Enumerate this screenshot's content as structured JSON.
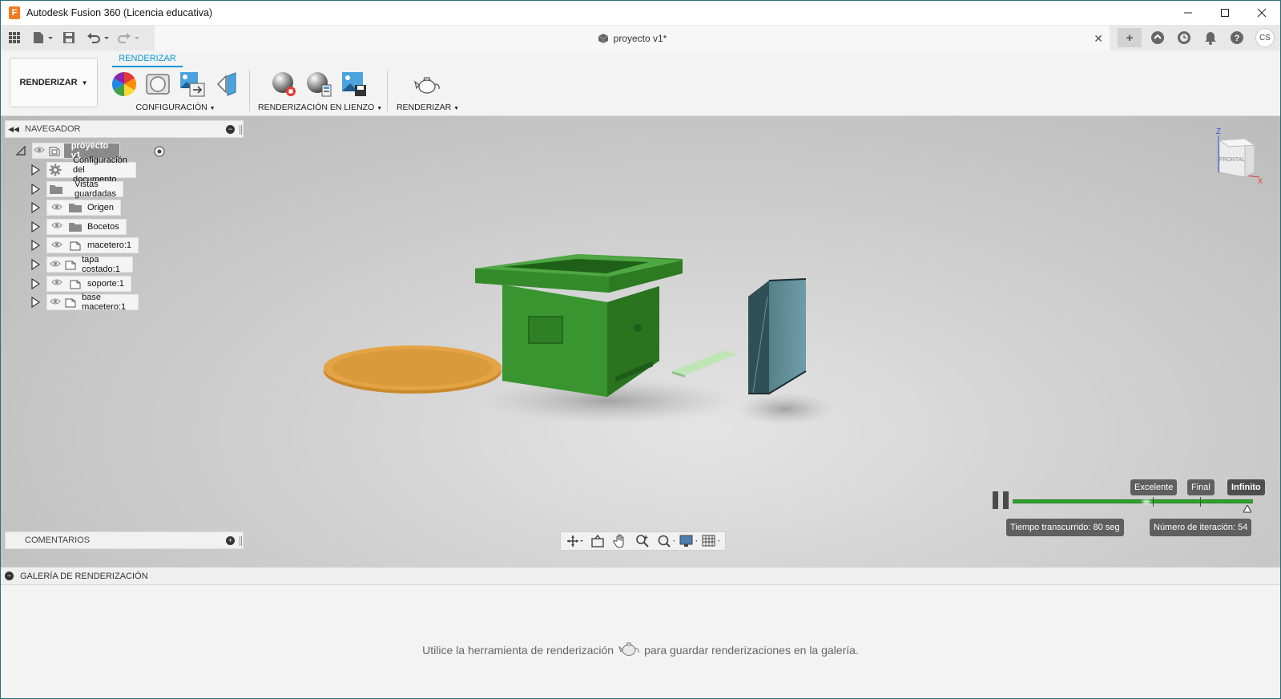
{
  "window": {
    "logo_letter": "F",
    "title": "Autodesk Fusion 360 (Licencia educativa)",
    "controls": [
      "minimize-icon",
      "maximize-icon",
      "close-icon"
    ]
  },
  "tabbar": {
    "document_title": "proyecto v1*",
    "close_glyph": "✕",
    "plus_glyph": "+",
    "avatar_initials": "CS"
  },
  "ribbon": {
    "workspace_label": "RENDERIZAR",
    "active_tab": "RENDERIZAR",
    "groups": [
      {
        "label": "CONFIGURACIÓN"
      },
      {
        "label": "RENDERIZACIÓN EN LIENZO"
      },
      {
        "label": "RENDERIZAR"
      }
    ]
  },
  "navigator": {
    "title": "NAVEGADOR",
    "root": "proyecto v1",
    "items": [
      {
        "label": "Configuración del documento",
        "icon": "gear-icon"
      },
      {
        "label": "Vistas guardadas",
        "icon": "folder-icon"
      },
      {
        "label": "Origen",
        "icon": "folder-icon"
      },
      {
        "label": "Bocetos",
        "icon": "folder-icon"
      },
      {
        "label": "macetero:1",
        "icon": "component-icon"
      },
      {
        "label": "tapa costado:1",
        "icon": "component-icon"
      },
      {
        "label": "soporte:1",
        "icon": "component-icon"
      },
      {
        "label": "base macetero:1",
        "icon": "component-icon"
      }
    ]
  },
  "comments": {
    "title": "COMENTARIOS"
  },
  "render_progress": {
    "qualities": [
      "Excelente",
      "Final",
      "Infinito"
    ],
    "active_quality": "Infinito",
    "elapsed": "Tiempo transcurrido: 80 seg",
    "iteration": "Número de iteración: 54",
    "progress_color": "#2fa22f"
  },
  "viewcube": {
    "face_label": "FRONTAL",
    "z_label": "Z",
    "x_label": "X"
  },
  "gallery": {
    "title": "GALERÍA DE RENDERIZACIÓN",
    "message_before": "Utilice la herramienta de renderización",
    "message_after": "para guardar renderizaciones en la galería."
  },
  "colors": {
    "accent": "#0696d7",
    "planter_green": "#3a8d2f",
    "dish_orange": "#d99a3a",
    "glass_blue": "#4a7f8c"
  }
}
